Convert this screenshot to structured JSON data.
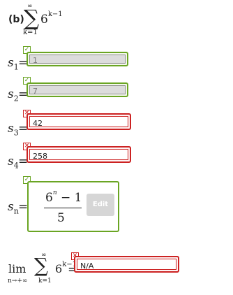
{
  "header": {
    "part_label": "(b)",
    "sum_upper": "∞",
    "sum_symbol": "∑",
    "sum_lower": "k=1",
    "term_base": "6",
    "term_exponent": "k−1"
  },
  "rows": [
    {
      "label_base": "s",
      "label_sub": "1",
      "equals": "=",
      "value": "1",
      "status": "correct",
      "status_symbol": "✓"
    },
    {
      "label_base": "s",
      "label_sub": "2",
      "equals": "=",
      "value": "7",
      "status": "correct",
      "status_symbol": "✓"
    },
    {
      "label_base": "s",
      "label_sub": "3",
      "equals": "=",
      "value": "42",
      "status": "incorrect",
      "status_symbol": "✕"
    },
    {
      "label_base": "s",
      "label_sub": "4",
      "equals": "=",
      "value": "258",
      "status": "incorrect",
      "status_symbol": "✕"
    }
  ],
  "sn": {
    "label_base": "s",
    "label_sub": "n",
    "equals": "=",
    "status_symbol": "✓",
    "numerator_base": "6",
    "numerator_exponent": "n",
    "numerator_rest": " − 1",
    "denominator": "5",
    "edit_label": "Edit"
  },
  "limit": {
    "lim": "lim",
    "lim_sub": "n→+∞",
    "sum_upper": "∞",
    "sum_symbol": "∑",
    "sum_lower": "k=1",
    "term_base": "6",
    "term_exponent": "k−1",
    "equals": "=",
    "value": "N/A",
    "status_symbol": "✕"
  },
  "colors": {
    "correct": "#6aa523",
    "incorrect": "#cc2222",
    "edit_button": "#d6d6d6"
  }
}
